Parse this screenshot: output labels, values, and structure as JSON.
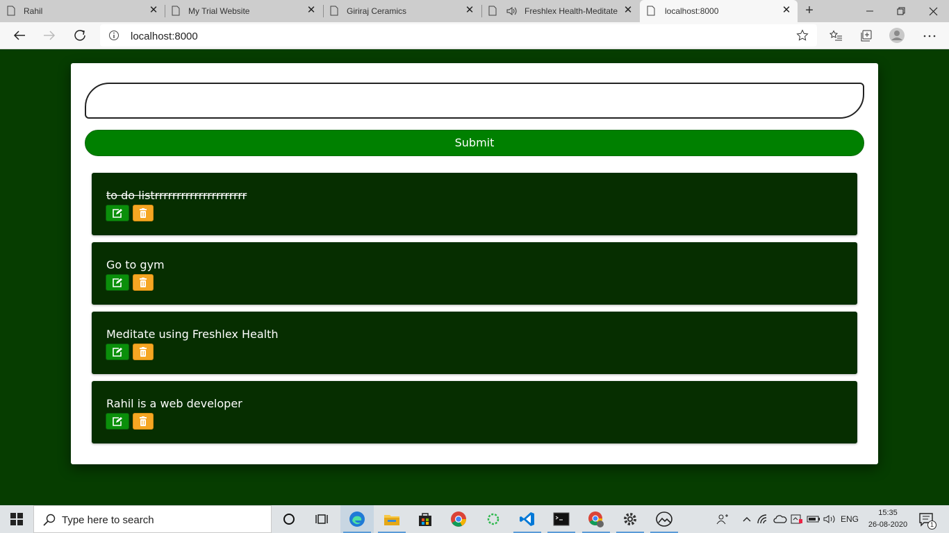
{
  "browser": {
    "tabs": [
      {
        "title": "Rahil",
        "audio": false,
        "active": false
      },
      {
        "title": "My Trial Website",
        "audio": false,
        "active": false
      },
      {
        "title": "Giriraj Ceramics",
        "audio": false,
        "active": false
      },
      {
        "title": "Freshlex Health-Meditate",
        "audio": true,
        "active": false
      },
      {
        "title": "localhost:8000",
        "audio": false,
        "active": true
      }
    ],
    "url": "localhost:8000"
  },
  "app": {
    "input_value": "",
    "submit_label": "Submit",
    "todos": [
      {
        "text": "to do listrrrrrrrrrrrrrrrrrrrrr",
        "completed": true
      },
      {
        "text": "Go to gym",
        "completed": false
      },
      {
        "text": "Meditate using Freshlex Health",
        "completed": false
      },
      {
        "text": "Rahil is a web developer",
        "completed": false
      }
    ]
  },
  "taskbar": {
    "search_placeholder": "Type here to search",
    "language": "ENG",
    "time": "15:35",
    "date": "26-08-2020",
    "notification_count": "1"
  },
  "colors": {
    "page_background": "#063d00",
    "todo_item_background": "#062e00",
    "submit_green": "#008000",
    "edit_green": "#0a8f0a",
    "delete_orange": "#f5a623"
  }
}
